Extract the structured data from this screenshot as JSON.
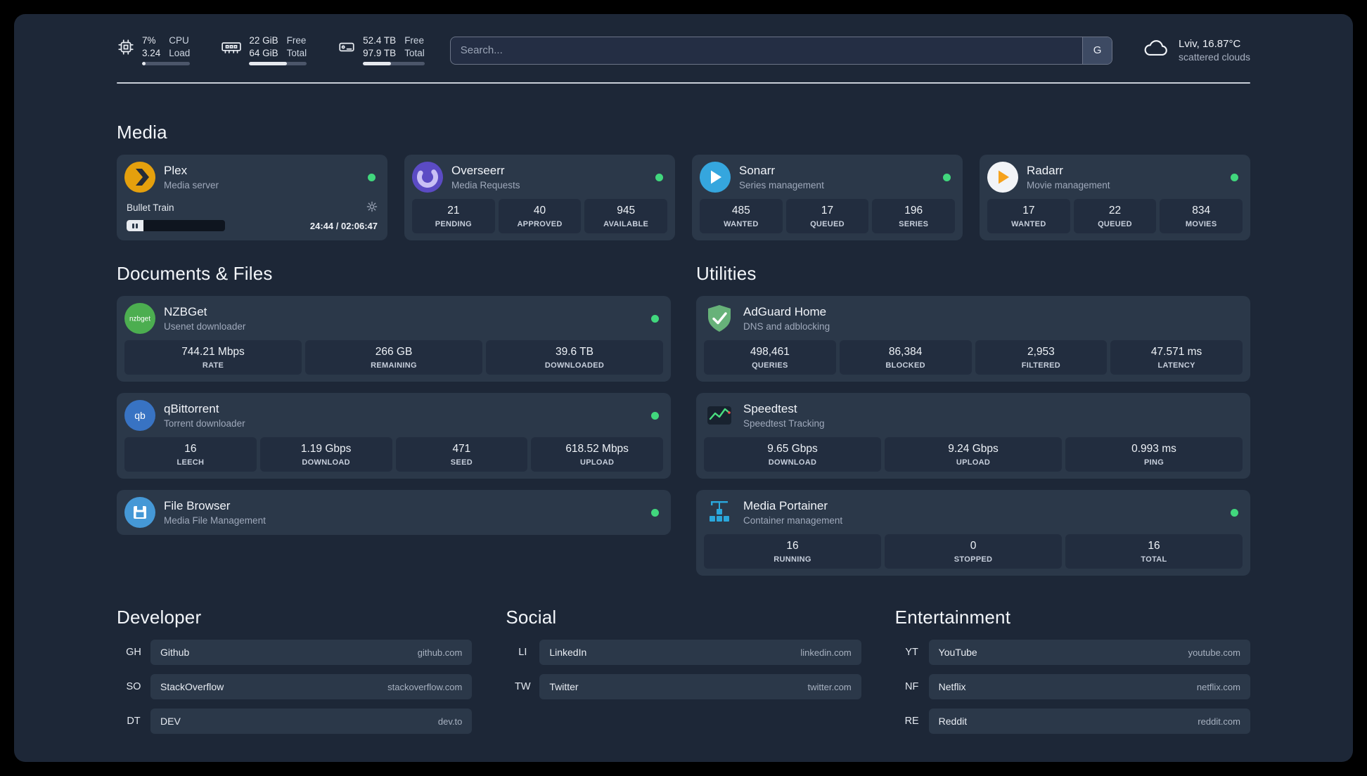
{
  "topbar": {
    "cpu": {
      "icon": "cpu-chip-icon",
      "values": [
        "7%",
        "3.24"
      ],
      "labels": [
        "CPU",
        "Load"
      ],
      "bar_width": "7%"
    },
    "memory": {
      "icon": "memory-icon",
      "values": [
        "22 GiB",
        "64 GiB"
      ],
      "labels": [
        "Free",
        "Total"
      ],
      "bar_width": "66%"
    },
    "disk": {
      "icon": "hard-drive-icon",
      "values": [
        "52.4 TB",
        "97.9 TB"
      ],
      "labels": [
        "Free",
        "Total"
      ],
      "bar_width": "46%"
    },
    "search": {
      "placeholder": "Search...",
      "button_label": "G"
    },
    "weather": {
      "icon": "cloud-icon",
      "location": "Lviv, 16.87°C",
      "condition": "scattered clouds"
    }
  },
  "colors": {
    "background": "#1d2737",
    "card": "#2b3849",
    "tile": "#222d3f",
    "status_online": "#41d77d"
  },
  "sections": {
    "media": {
      "title": "Media",
      "cards": [
        {
          "icon": "plex-icon",
          "name": "Plex",
          "subtitle": "Media server",
          "status_color": "#41d77d",
          "player": {
            "track": "Bullet Train",
            "time": "24:44 / 02:06:47",
            "progress_width": "17%"
          }
        },
        {
          "icon": "overseerr-icon",
          "name": "Overseerr",
          "subtitle": "Media Requests",
          "status_color": "#41d77d",
          "stats": [
            {
              "value": "21",
              "label": "PENDING"
            },
            {
              "value": "40",
              "label": "APPROVED"
            },
            {
              "value": "945",
              "label": "AVAILABLE"
            }
          ]
        },
        {
          "icon": "sonarr-icon",
          "name": "Sonarr",
          "subtitle": "Series management",
          "status_color": "#41d77d",
          "stats": [
            {
              "value": "485",
              "label": "WANTED"
            },
            {
              "value": "17",
              "label": "QUEUED"
            },
            {
              "value": "196",
              "label": "SERIES"
            }
          ]
        },
        {
          "icon": "radarr-icon",
          "name": "Radarr",
          "subtitle": "Movie management",
          "status_color": "#41d77d",
          "stats": [
            {
              "value": "17",
              "label": "WANTED"
            },
            {
              "value": "22",
              "label": "QUEUED"
            },
            {
              "value": "834",
              "label": "MOVIES"
            }
          ]
        }
      ]
    },
    "documents": {
      "title": "Documents & Files",
      "cards": [
        {
          "icon": "nzbget-icon",
          "name": "NZBGet",
          "subtitle": "Usenet downloader",
          "status_color": "#41d77d",
          "stats": [
            {
              "value": "744.21 Mbps",
              "label": "RATE"
            },
            {
              "value": "266 GB",
              "label": "REMAINING"
            },
            {
              "value": "39.6 TB",
              "label": "DOWNLOADED"
            }
          ]
        },
        {
          "icon": "qbittorrent-icon",
          "name": "qBittorrent",
          "subtitle": "Torrent downloader",
          "status_color": "#41d77d",
          "stats": [
            {
              "value": "16",
              "label": "LEECH"
            },
            {
              "value": "1.19 Gbps",
              "label": "DOWNLOAD"
            },
            {
              "value": "471",
              "label": "SEED"
            },
            {
              "value": "618.52 Mbps",
              "label": "UPLOAD"
            }
          ]
        },
        {
          "icon": "filebrowser-icon",
          "name": "File Browser",
          "subtitle": "Media File Management",
          "status_color": "#41d77d"
        }
      ]
    },
    "utilities": {
      "title": "Utilities",
      "cards": [
        {
          "icon": "adguard-icon",
          "name": "AdGuard Home",
          "subtitle": "DNS and adblocking",
          "stats": [
            {
              "value": "498,461",
              "label": "QUERIES"
            },
            {
              "value": "86,384",
              "label": "BLOCKED"
            },
            {
              "value": "2,953",
              "label": "FILTERED"
            },
            {
              "value": "47.571 ms",
              "label": "LATENCY"
            }
          ]
        },
        {
          "icon": "speedtest-icon",
          "name": "Speedtest",
          "subtitle": "Speedtest Tracking",
          "stats": [
            {
              "value": "9.65 Gbps",
              "label": "DOWNLOAD"
            },
            {
              "value": "9.24 Gbps",
              "label": "UPLOAD"
            },
            {
              "value": "0.993 ms",
              "label": "PING"
            }
          ]
        },
        {
          "icon": "portainer-icon",
          "name": "Media Portainer",
          "subtitle": "Container management",
          "status_color": "#41d77d",
          "stats": [
            {
              "value": "16",
              "label": "RUNNING"
            },
            {
              "value": "0",
              "label": "STOPPED"
            },
            {
              "value": "16",
              "label": "TOTAL"
            }
          ]
        }
      ]
    }
  },
  "bookmarks": {
    "groups": [
      {
        "title": "Developer",
        "items": [
          {
            "abbr": "GH",
            "name": "Github",
            "url": "github.com"
          },
          {
            "abbr": "SO",
            "name": "StackOverflow",
            "url": "stackoverflow.com"
          },
          {
            "abbr": "DT",
            "name": "DEV",
            "url": "dev.to"
          }
        ]
      },
      {
        "title": "Social",
        "items": [
          {
            "abbr": "LI",
            "name": "LinkedIn",
            "url": "linkedin.com"
          },
          {
            "abbr": "TW",
            "name": "Twitter",
            "url": "twitter.com"
          }
        ]
      },
      {
        "title": "Entertainment",
        "items": [
          {
            "abbr": "YT",
            "name": "YouTube",
            "url": "youtube.com"
          },
          {
            "abbr": "NF",
            "name": "Netflix",
            "url": "netflix.com"
          },
          {
            "abbr": "RE",
            "name": "Reddit",
            "url": "reddit.com"
          }
        ]
      }
    ]
  }
}
